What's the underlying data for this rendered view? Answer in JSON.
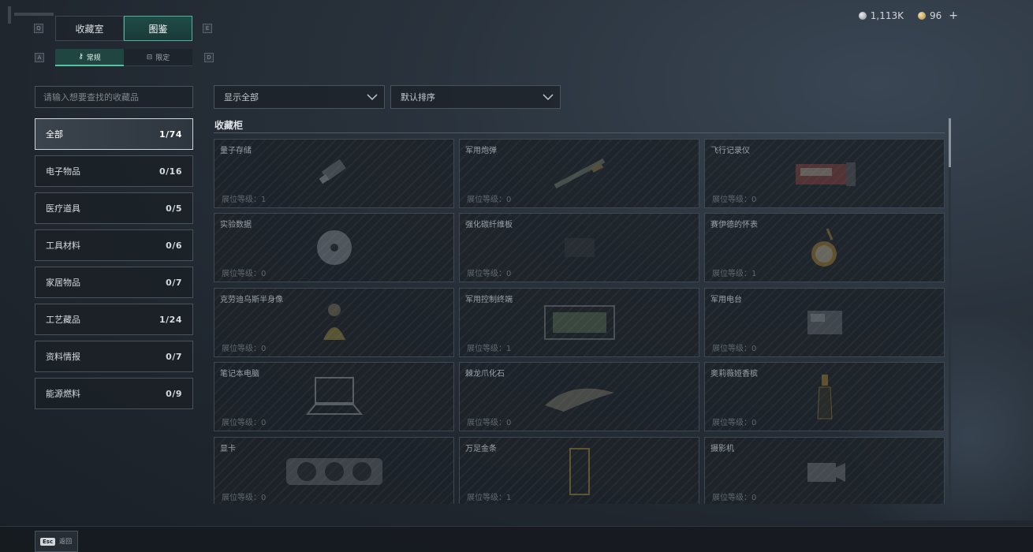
{
  "currency": {
    "silver": "1,113K",
    "gold": "96",
    "plus": "+"
  },
  "keys": {
    "q": "Q",
    "e": "E",
    "a": "A",
    "d": "D"
  },
  "tabs": [
    {
      "label": "收藏室"
    },
    {
      "label": "图鉴"
    }
  ],
  "subtabs": [
    {
      "label": "常规"
    },
    {
      "label": "限定"
    }
  ],
  "search": {
    "placeholder": "请输入想要查找的收藏品"
  },
  "categories": [
    {
      "label": "全部",
      "count": "1/74"
    },
    {
      "label": "电子物品",
      "count": "0/16"
    },
    {
      "label": "医疗道具",
      "count": "0/5"
    },
    {
      "label": "工具材料",
      "count": "0/6"
    },
    {
      "label": "家居物品",
      "count": "0/7"
    },
    {
      "label": "工艺藏品",
      "count": "1/24"
    },
    {
      "label": "资料情报",
      "count": "0/7"
    },
    {
      "label": "能源燃料",
      "count": "0/9"
    }
  ],
  "filters": {
    "show": "显示全部",
    "sort": "默认排序"
  },
  "section": {
    "title": "收藏柜"
  },
  "level_prefix": "展位等级：",
  "items": [
    {
      "name": "量子存储",
      "level": "展位等级：1",
      "icon": "usb-drive-icon"
    },
    {
      "name": "军用炮弹",
      "level": "展位等级：0",
      "icon": "shell-icon"
    },
    {
      "name": "飞行记录仪",
      "level": "展位等级：0",
      "icon": "flight-recorder-icon"
    },
    {
      "name": "实验数据",
      "level": "展位等级：0",
      "icon": "disc-icon"
    },
    {
      "name": "强化碳纤维板",
      "level": "展位等级：0",
      "icon": "carbon-plate-icon"
    },
    {
      "name": "赛伊德的怀表",
      "level": "展位等级：1",
      "icon": "pocket-watch-icon"
    },
    {
      "name": "克劳迪乌斯半身像",
      "level": "展位等级：0",
      "icon": "bust-icon"
    },
    {
      "name": "军用控制终端",
      "level": "展位等级：1",
      "icon": "terminal-icon"
    },
    {
      "name": "军用电台",
      "level": "展位等级：0",
      "icon": "radio-icon"
    },
    {
      "name": "笔记本电脑",
      "level": "展位等级：0",
      "icon": "laptop-icon"
    },
    {
      "name": "棘龙爪化石",
      "level": "展位等级：0",
      "icon": "fossil-icon"
    },
    {
      "name": "奥莉薇娅香槟",
      "level": "展位等级：0",
      "icon": "champagne-icon"
    },
    {
      "name": "显卡",
      "level": "展位等级：0",
      "icon": "gpu-icon"
    },
    {
      "name": "万足金条",
      "level": "展位等级：1",
      "icon": "gold-bar-icon"
    },
    {
      "name": "摄影机",
      "level": "展位等级：0",
      "icon": "camera-icon"
    }
  ],
  "bottom": {
    "esc": "Esc",
    "back": "返回"
  }
}
